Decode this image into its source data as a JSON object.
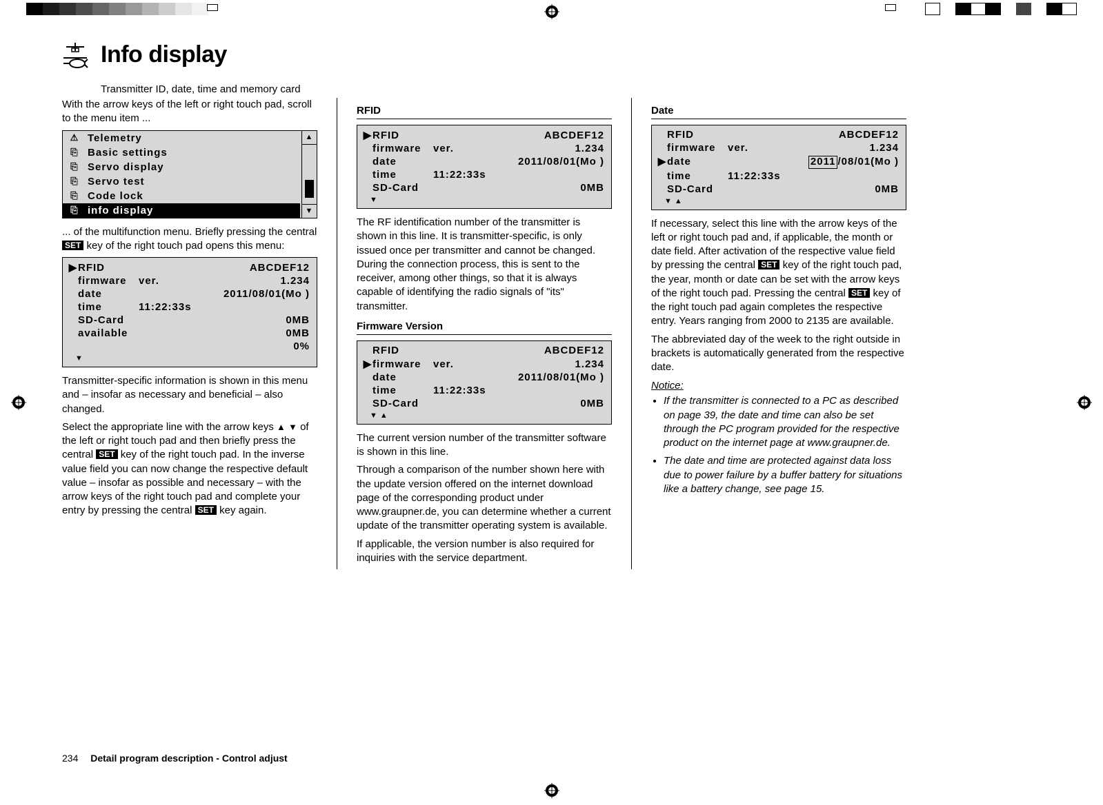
{
  "title": "Info display",
  "subtitle": "Transmitter ID, date, time and memory card",
  "intro": "With the arrow keys of the left or right touch pad, scroll to the menu item ...",
  "menu": {
    "items": [
      {
        "icon": "warn",
        "label": "Telemetry"
      },
      {
        "icon": "folder",
        "label": "Basic settings"
      },
      {
        "icon": "folder",
        "label": "Servo display"
      },
      {
        "icon": "folder",
        "label": "Servo test"
      },
      {
        "icon": "folder",
        "label": "Code lock"
      },
      {
        "icon": "folder",
        "label": "info display",
        "selected": true
      }
    ]
  },
  "after_menu_1": "... of the multifunction menu. Briefly pressing the central ",
  "after_menu_2": " key of the right touch pad opens this menu:",
  "set_label": "SET",
  "lcd_main": {
    "rfid_label": "RFID",
    "rfid_val": "ABCDEF12",
    "fw_label": "firmware",
    "fw_mid": "ver.",
    "fw_val": "1.234",
    "date_label": "date",
    "date_val": "2011/08/01(Mo )",
    "time_label": "time",
    "time_val": "11:22:33s",
    "sd_label": "SD-Card",
    "sd_val": "0MB",
    "avail_label": "available",
    "avail_val": "0MB",
    "pct": "0%"
  },
  "para2": "Transmitter-specific information is shown in this menu and  – insofar as necessary and beneficial – also changed.",
  "para3a": "Select the appropriate line with the arrow keys ",
  "para3b": " of the left or right touch pad and then briefly press the central ",
  "para3c": " key of the right touch pad. In the inverse value field you can now change the respective default value – insofar as possible and necessary – with the arrow keys of the right touch pad and complete your entry by pressing the central ",
  "para3d": " key again.",
  "sections": {
    "rfid": {
      "heading": "RFID",
      "lcd": {
        "rfid_label": "RFID",
        "rfid_val": "ABCDEF12",
        "cursor_row": "rfid",
        "fw_label": "firmware",
        "fw_mid": "ver.",
        "fw_val": "1.234",
        "date_label": "date",
        "date_val": "2011/08/01(Mo )",
        "time_label": "time",
        "time_val": "11:22:33s",
        "sd_label": "SD-Card",
        "sd_val": "0MB"
      },
      "text": "The RF identification number of the transmitter is shown in this line. It is transmitter-specific, is only issued once per transmitter and cannot be changed. During the connection process, this is sent to the receiver, among other  things, so that it is always capable of identifying the radio signals of \"its\" transmitter."
    },
    "fw": {
      "heading": "Firmware Version",
      "lcd": {
        "rfid_label": "RFID",
        "rfid_val": "ABCDEF12",
        "fw_label": "firmware",
        "fw_mid": "ver.",
        "fw_val": "1.234",
        "cursor_row": "fw",
        "date_label": "date",
        "date_val": "2011/08/01(Mo )",
        "time_label": "time",
        "time_val": "11:22:33s",
        "sd_label": "SD-Card",
        "sd_val": "0MB"
      },
      "text1": "The current version number of the transmitter software is shown in this line.",
      "text2": "Through a comparison of the number shown here with the update version offered on the internet download page of the corresponding product under www.graupner.de, you can determine whether a current update of the transmitter operating system is available.",
      "text3": "If applicable, the version number is also required for inquiries with the service department."
    },
    "date": {
      "heading": "Date",
      "lcd": {
        "rfid_label": "RFID",
        "rfid_val": "ABCDEF12",
        "fw_label": "firmware",
        "fw_mid": "ver.",
        "fw_val": "1.234",
        "date_label": "date",
        "date_year_box": "2011",
        "date_rest": "/08/01(Mo )",
        "cursor_row": "date",
        "time_label": "time",
        "time_val": "11:22:33s",
        "sd_label": "SD-Card",
        "sd_val": "0MB"
      },
      "text1a": "If necessary, select this line with the arrow keys of the left or right touch pad and, if applicable, the month or date field. After activation of the respective value field by pressing the central ",
      "text1b": " key of the right touch pad, the year, month or date can be set with the arrow keys of the right touch pad. Pressing the central ",
      "text1c": " key of the right touch pad again completes the respective entry. Years ranging from 2000 to 2135 are available.",
      "text2": "The abbreviated day of the week to the right outside in brackets is automatically generated from the respective date.",
      "notice_heading": "Notice:",
      "notice_items": [
        "If the transmitter is connected to a PC as described on page 39, the date and time can also be set through the PC program provided for the respective product on the internet page at www.graupner.de.",
        "The date and time are protected against data loss due to power failure by a buffer battery for situations like a battery change, see page 15."
      ]
    }
  },
  "footer": {
    "page": "234",
    "title": "Detail program description - Control adjust"
  }
}
